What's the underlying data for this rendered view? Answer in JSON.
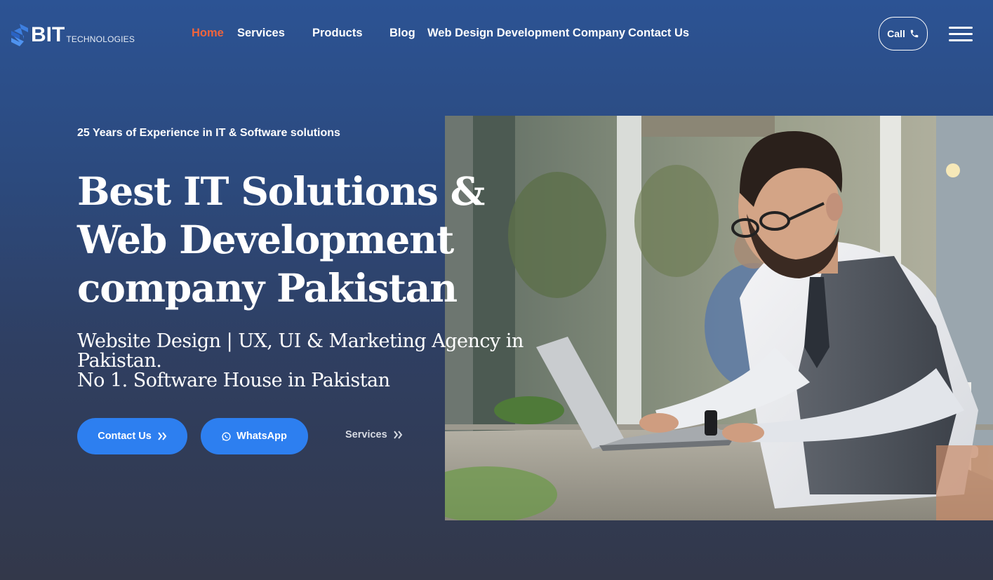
{
  "brand": {
    "name": "BIT",
    "tagline": "TECHNOLOGIES",
    "accent": "#2d7ff0",
    "active_nav_color": "#f0643c"
  },
  "nav": {
    "items": [
      {
        "label": "Home",
        "active": true
      },
      {
        "label": "Services"
      },
      {
        "label": "Products"
      },
      {
        "label": "Blog"
      },
      {
        "label": "Web Design Development Company"
      },
      {
        "label": "Contact Us"
      }
    ],
    "call_label": "Call",
    "call_icon": "phone-icon",
    "menu_icon": "hamburger-menu-icon"
  },
  "hero": {
    "eyebrow": "25 Years of Experience in IT & Software solutions",
    "title": "Best IT Solutions & Web Development company Pakistan",
    "subtitle_line1": "Website Design | UX, UI & Marketing Agency in Pakistan.",
    "subtitle_line2": "No 1. Software House in Pakistan",
    "buttons": {
      "contact": "Contact Us",
      "whatsapp": "WhatsApp",
      "services": "Services"
    },
    "image": "man-with-laptop-photo"
  }
}
